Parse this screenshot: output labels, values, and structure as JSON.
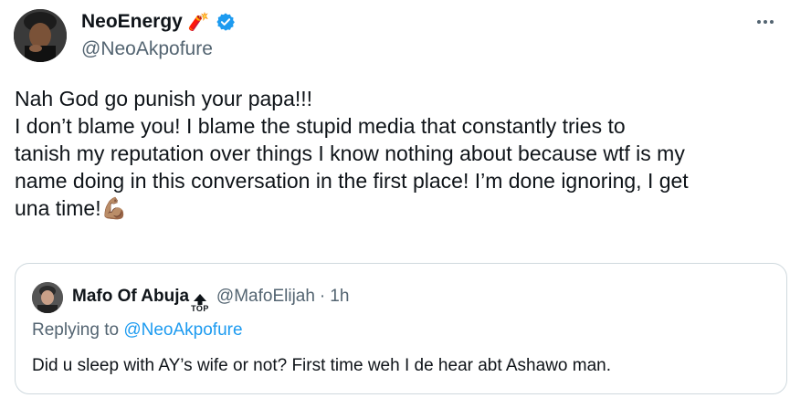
{
  "author": {
    "display_name": "NeoEnergy",
    "name_emoji": "🧨",
    "verified_icon": "verified-badge-icon",
    "handle": "@NeoAkpofure"
  },
  "more_icon": "more-options-icon",
  "tweet": {
    "lines": [
      "Nah God go punish your papa!!!",
      "I don’t blame you! I blame the stupid media that constantly tries to",
      "tanish my reputation over things I know nothing about because wtf is my",
      "name doing in this conversation in the first place! I’m done ignoring, I get",
      "una time!"
    ],
    "trailing_emoji": "💪🏽"
  },
  "quote": {
    "display_name": "Mafo Of Abuja",
    "name_badge_text": "TOP",
    "handle": "@MafoElijah",
    "separator": "·",
    "time": "1h",
    "replying_prefix": "Replying to",
    "replying_to": "@NeoAkpofure",
    "text": "Did u sleep with AY’s wife or not? First time weh I de hear abt Ashawo man."
  },
  "colors": {
    "text_primary": "#0f1419",
    "text_secondary": "#536471",
    "link": "#1d9bf0",
    "verified": "#1d9bf0",
    "border": "#cfd9de"
  }
}
